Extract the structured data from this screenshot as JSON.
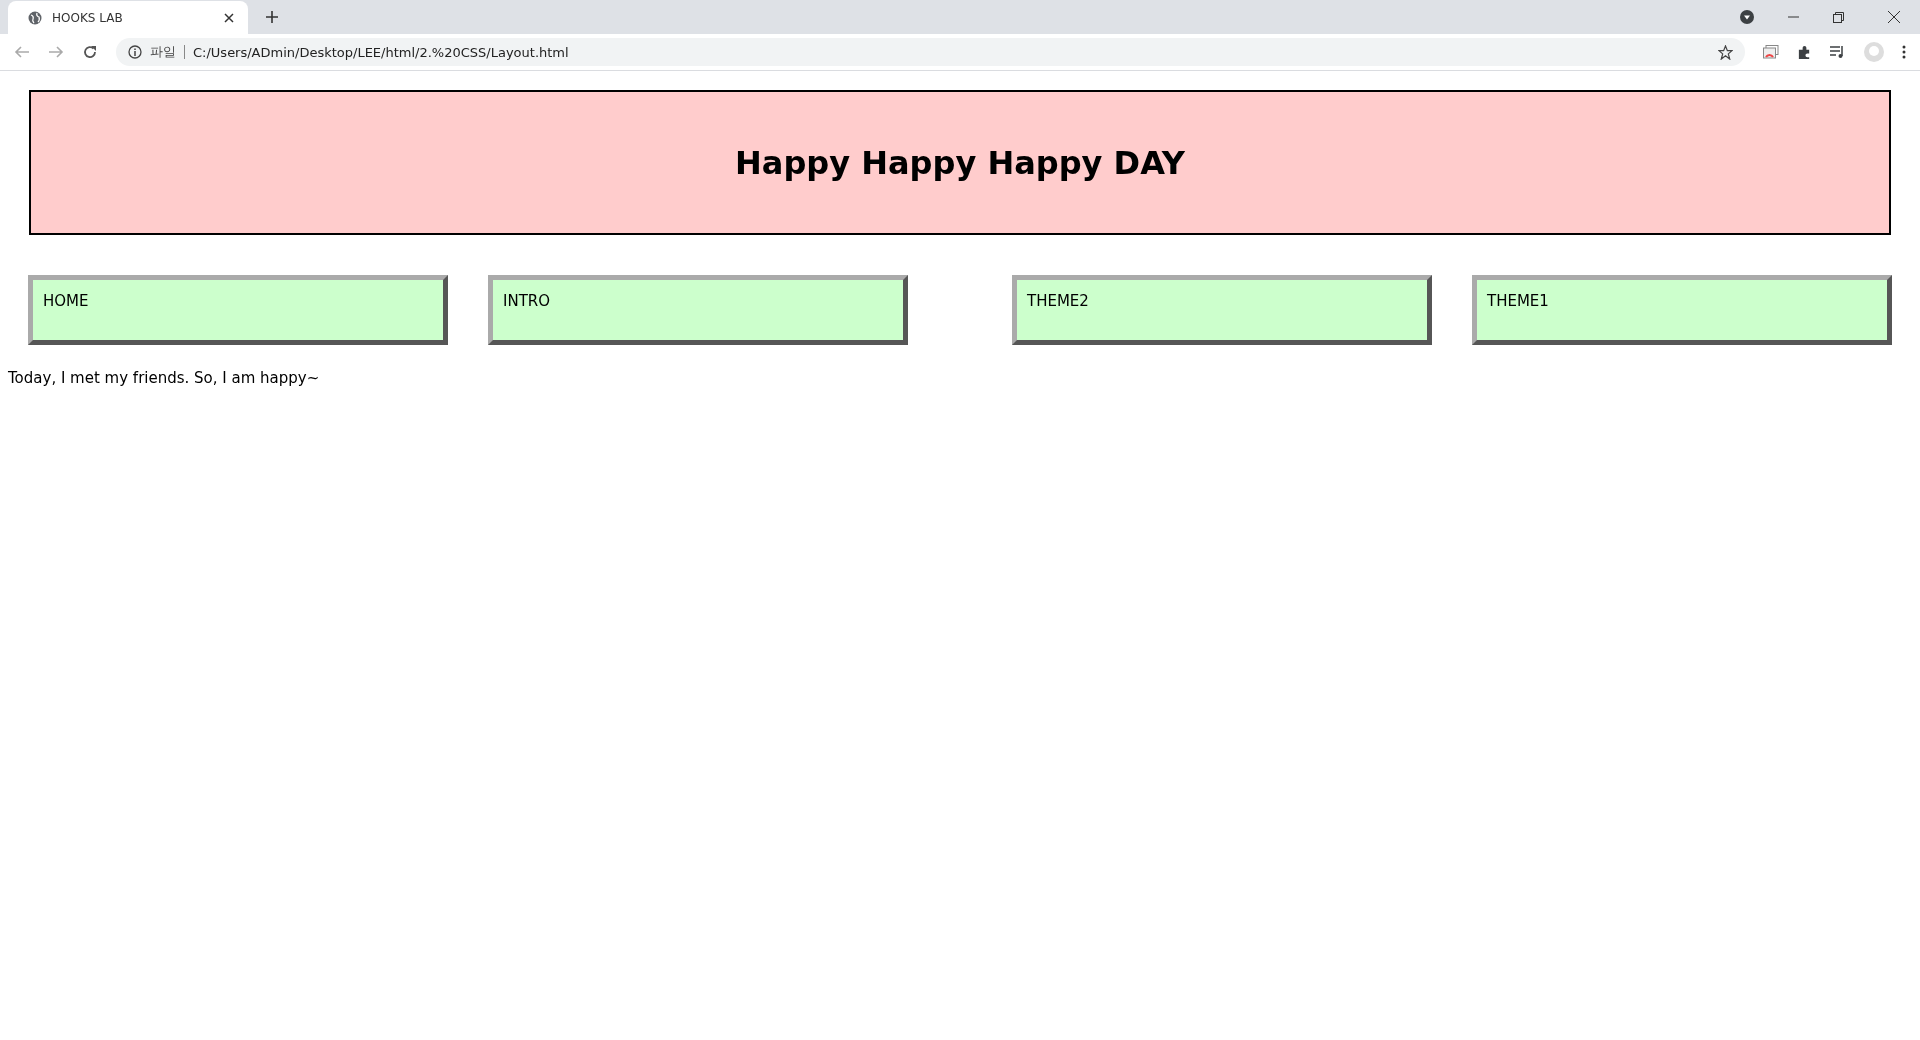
{
  "browser": {
    "tab_title": "HOOKS LAB",
    "address_prefix": "파일",
    "url": "C:/Users/ADmin/Desktop/LEE/html/2.%20CSS/Layout.html"
  },
  "header": {
    "title": "Happy Happy Happy DAY"
  },
  "nav": {
    "left": [
      {
        "label": "HOME"
      },
      {
        "label": "INTRO"
      }
    ],
    "right": [
      {
        "label": "THEME2"
      },
      {
        "label": "THEME1"
      }
    ]
  },
  "body_text": "Today, I met my friends. So, I am happy~"
}
